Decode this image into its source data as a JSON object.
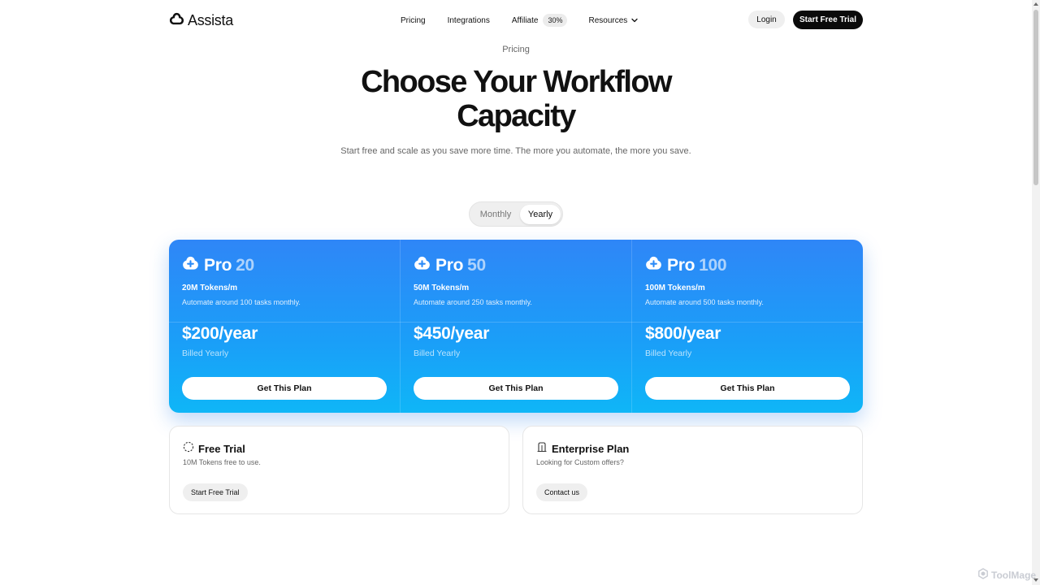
{
  "header": {
    "brand": "Assista",
    "nav": {
      "pricing": "Pricing",
      "integrations": "Integrations",
      "affiliate": "Affiliate",
      "affiliate_badge": "30%",
      "resources": "Resources"
    },
    "login_label": "Login",
    "trial_label": "Start Free Trial"
  },
  "hero": {
    "eyebrow": "Pricing",
    "title_line1": "Choose Your Workflow",
    "title_line2": "Capacity",
    "subtitle": "Start free and scale as you save more time. The more you automate, the more you save."
  },
  "billing_toggle": {
    "monthly": "Monthly",
    "yearly": "Yearly",
    "selected": "Yearly"
  },
  "plans": [
    {
      "name": "Pro",
      "tier": "20",
      "tokens": "20M Tokens/m",
      "description": "Automate around 100 tasks monthly.",
      "price": "$200/year",
      "billing": "Billed Yearly",
      "cta": "Get This Plan"
    },
    {
      "name": "Pro",
      "tier": "50",
      "tokens": "50M Tokens/m",
      "description": "Automate around 250 tasks monthly.",
      "price": "$450/year",
      "billing": "Billed Yearly",
      "cta": "Get This Plan"
    },
    {
      "name": "Pro",
      "tier": "100",
      "tokens": "100M Tokens/m",
      "description": "Automate around 500 tasks monthly.",
      "price": "$800/year",
      "billing": "Billed Yearly",
      "cta": "Get This Plan"
    }
  ],
  "free_trial": {
    "title": "Free Trial",
    "description": "10M Tokens free to use.",
    "cta": "Start Free Trial"
  },
  "enterprise": {
    "title": "Enterprise Plan",
    "description": "Looking for Custom offers?",
    "cta": "Contact us"
  },
  "watermark": "ToolMage",
  "icons": {
    "logo": "assista-cloud-logo-icon",
    "plan": "cloud-plus-icon",
    "free_trial": "dashed-circle-icon",
    "enterprise": "building-icon",
    "resources_chevron": "chevron-down-icon"
  },
  "colors": {
    "plan_gradient_top": "#2f86f7",
    "plan_gradient_bottom": "#0fb6f7",
    "primary_button": "#0b0b0b"
  }
}
